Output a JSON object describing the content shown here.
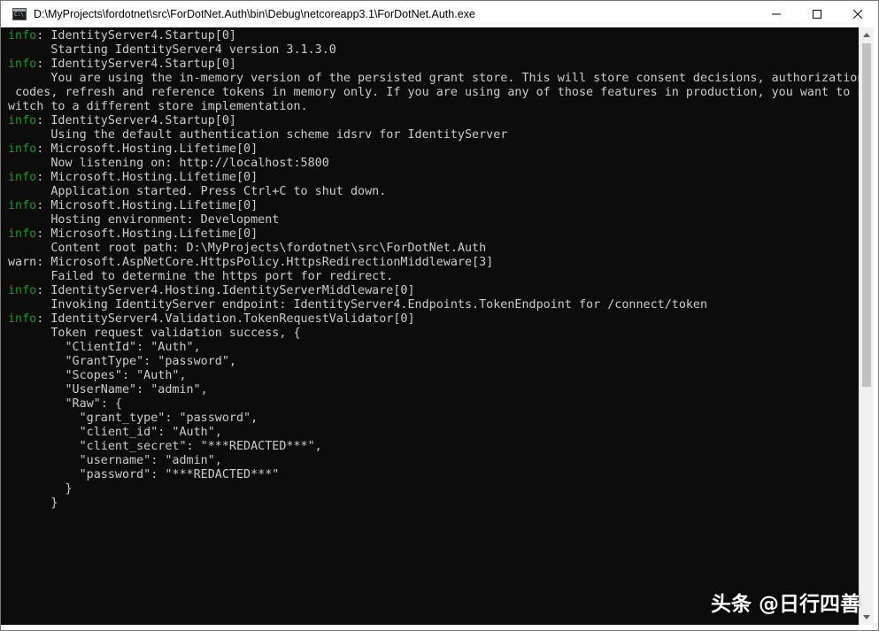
{
  "window": {
    "title": "D:\\MyProjects\\fordotnet\\src\\ForDotNet.Auth\\bin\\Debug\\netcoreapp3.1\\ForDotNet.Auth.exe",
    "icon": "console-app-icon",
    "buttons": [
      "minimize",
      "maximize",
      "close"
    ]
  },
  "colors": {
    "console_bg": "#0c0c0c",
    "console_text": "#cccccc",
    "info_level": "#13a10e",
    "titlebar_bg": "#ffffff"
  },
  "console": {
    "lines": [
      {
        "level": "info",
        "text": ": IdentityServer4.Startup[0]"
      },
      {
        "level": "",
        "text": "      Starting IdentityServer4 version 3.1.3.0"
      },
      {
        "level": "info",
        "text": ": IdentityServer4.Startup[0]"
      },
      {
        "level": "",
        "text": "      You are using the in-memory version of the persisted grant store. This will store consent decisions, authorization"
      },
      {
        "level": "",
        "text": " codes, refresh and reference tokens in memory only. If you are using any of those features in production, you want to s"
      },
      {
        "level": "",
        "text": "witch to a different store implementation."
      },
      {
        "level": "info",
        "text": ": IdentityServer4.Startup[0]"
      },
      {
        "level": "",
        "text": "      Using the default authentication scheme idsrv for IdentityServer"
      },
      {
        "level": "info",
        "text": ": Microsoft.Hosting.Lifetime[0]"
      },
      {
        "level": "",
        "text": "      Now listening on: http://localhost:5800"
      },
      {
        "level": "info",
        "text": ": Microsoft.Hosting.Lifetime[0]"
      },
      {
        "level": "",
        "text": "      Application started. Press Ctrl+C to shut down."
      },
      {
        "level": "info",
        "text": ": Microsoft.Hosting.Lifetime[0]"
      },
      {
        "level": "",
        "text": "      Hosting environment: Development"
      },
      {
        "level": "info",
        "text": ": Microsoft.Hosting.Lifetime[0]"
      },
      {
        "level": "",
        "text": "      Content root path: D:\\MyProjects\\fordotnet\\src\\ForDotNet.Auth"
      },
      {
        "level": "warn",
        "text": ": Microsoft.AspNetCore.HttpsPolicy.HttpsRedirectionMiddleware[3]"
      },
      {
        "level": "",
        "text": "      Failed to determine the https port for redirect."
      },
      {
        "level": "info",
        "text": ": IdentityServer4.Hosting.IdentityServerMiddleware[0]"
      },
      {
        "level": "",
        "text": "      Invoking IdentityServer endpoint: IdentityServer4.Endpoints.TokenEndpoint for /connect/token"
      },
      {
        "level": "info",
        "text": ": IdentityServer4.Validation.TokenRequestValidator[0]"
      },
      {
        "level": "",
        "text": "      Token request validation success, {"
      },
      {
        "level": "",
        "text": "        \"ClientId\": \"Auth\","
      },
      {
        "level": "",
        "text": "        \"GrantType\": \"password\","
      },
      {
        "level": "",
        "text": "        \"Scopes\": \"Auth\","
      },
      {
        "level": "",
        "text": "        \"UserName\": \"admin\","
      },
      {
        "level": "",
        "text": "        \"Raw\": {"
      },
      {
        "level": "",
        "text": "          \"grant_type\": \"password\","
      },
      {
        "level": "",
        "text": "          \"client_id\": \"Auth\","
      },
      {
        "level": "",
        "text": "          \"client_secret\": \"***REDACTED***\","
      },
      {
        "level": "",
        "text": "          \"username\": \"admin\","
      },
      {
        "level": "",
        "text": "          \"password\": \"***REDACTED***\""
      },
      {
        "level": "",
        "text": "        }"
      },
      {
        "level": "",
        "text": "      }"
      }
    ]
  },
  "watermark": {
    "text": "头条 @日行四善"
  }
}
